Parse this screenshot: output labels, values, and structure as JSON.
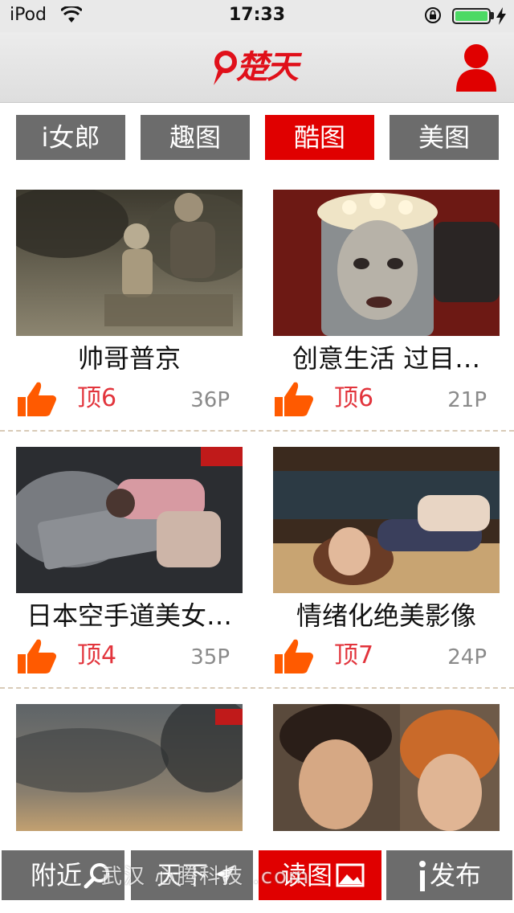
{
  "status_bar": {
    "carrier": "iPod",
    "time": "17:33"
  },
  "header": {
    "logo_text": "楚天",
    "brand_color": "#e0101a"
  },
  "tabs": [
    {
      "label": "i女郎",
      "active": false
    },
    {
      "label": "趣图",
      "active": false
    },
    {
      "label": "酷图",
      "active": true
    },
    {
      "label": "美图",
      "active": false
    }
  ],
  "items": [
    {
      "title": "帅哥普京",
      "likes": "顶6",
      "count": "36P"
    },
    {
      "title": "创意生活 过目…",
      "likes": "顶6",
      "count": "21P"
    },
    {
      "title": "日本空手道美女…",
      "likes": "顶4",
      "count": "35P"
    },
    {
      "title": "情绪化绝美影像",
      "likes": "顶7",
      "count": "24P"
    }
  ],
  "bottom_tabs": [
    {
      "label": "附近",
      "icon": "search-icon",
      "active": false
    },
    {
      "label": "天下",
      "icon": "plane-icon",
      "active": false
    },
    {
      "label": "读图",
      "icon": "image-icon",
      "active": true
    },
    {
      "label": "发布",
      "icon": "info-icon",
      "active": false
    }
  ],
  "watermark": "武汉 心腾科技 .com",
  "colors": {
    "active_tab": "#e00000",
    "inactive_tab": "#6c6c6c",
    "like_icon": "#ff5a00",
    "like_text": "#e2343c"
  }
}
